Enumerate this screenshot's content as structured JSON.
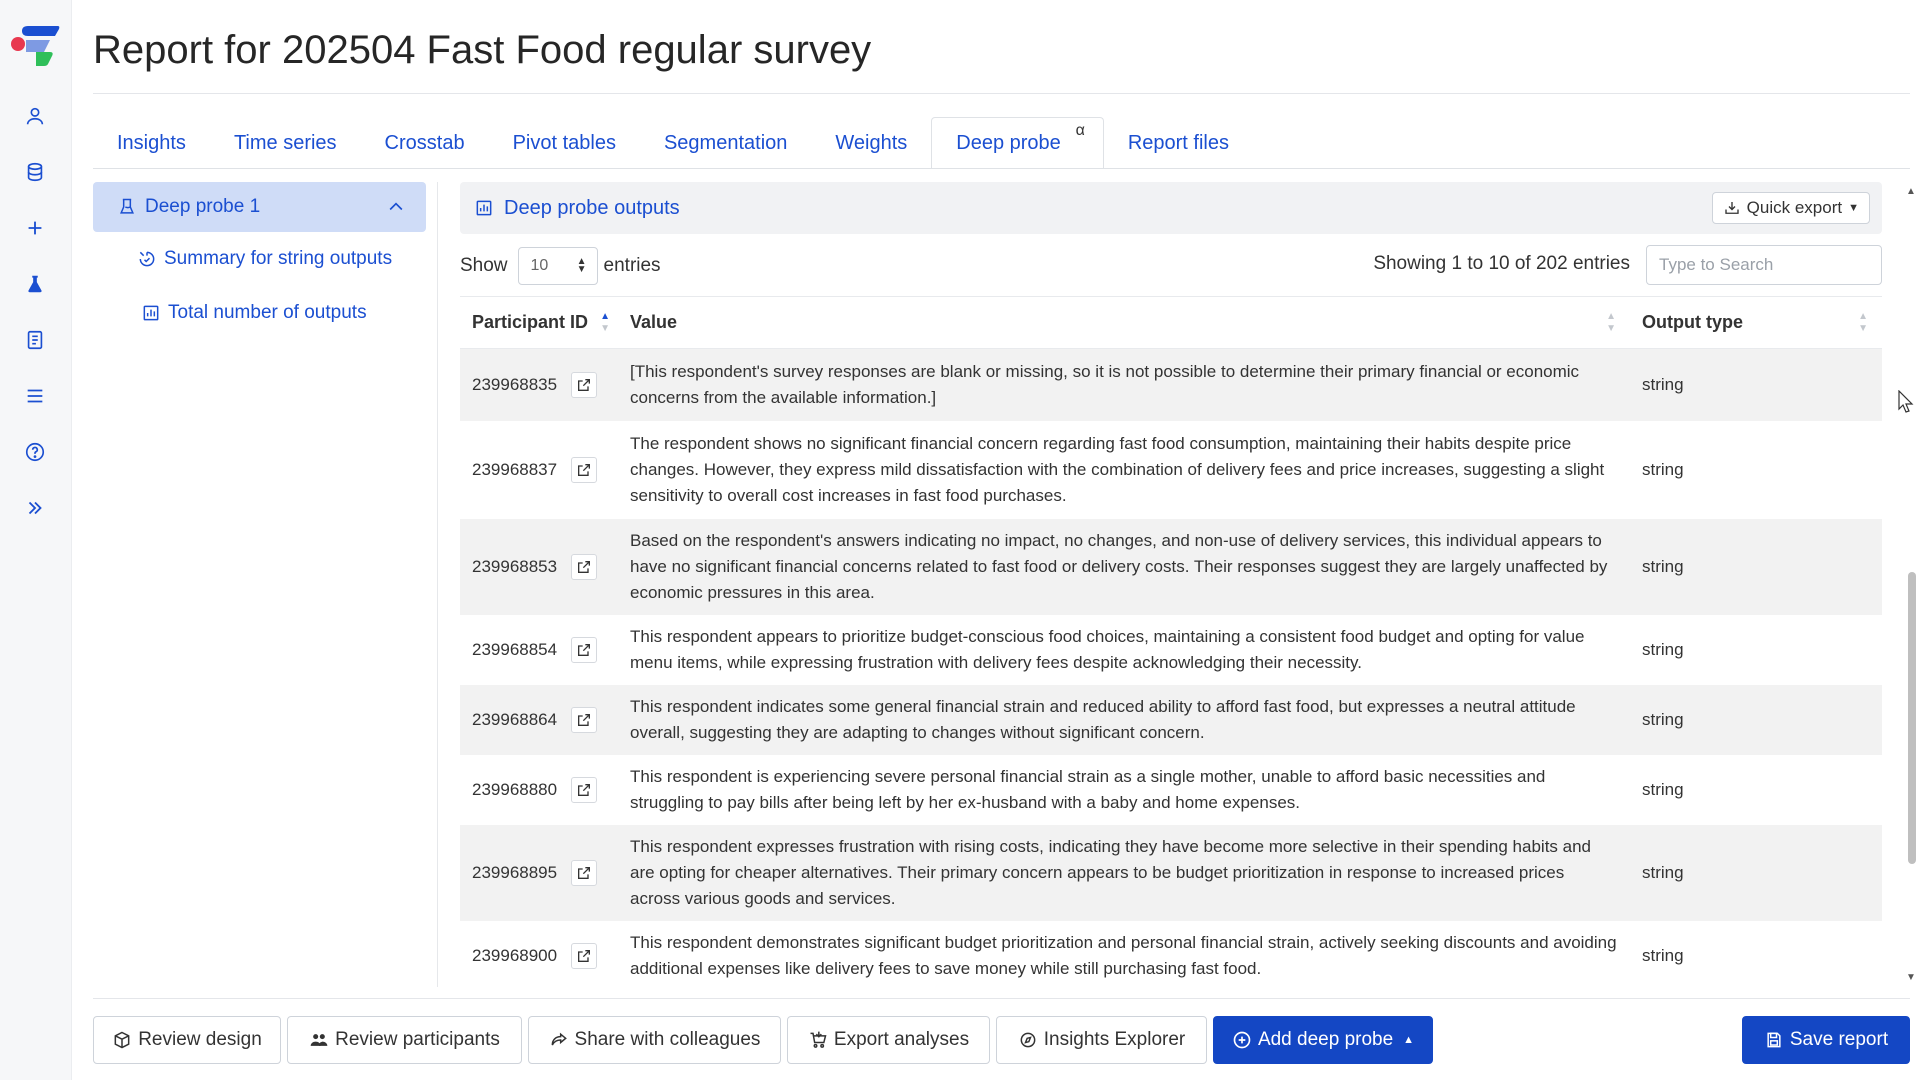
{
  "colors": {
    "accent": "#1b4fd1",
    "primary_button": "#1447c4",
    "selected_tree_bg": "#cfdcf7",
    "stripe": "#f2f2f2"
  },
  "rail": {
    "icons": [
      "user-icon",
      "database-icon",
      "plus-icon",
      "flask-icon",
      "book-icon",
      "menu-icon",
      "help-icon",
      "expand-icon"
    ]
  },
  "page": {
    "title": "Report for 202504 Fast Food regular survey"
  },
  "tabs": [
    {
      "label": "Insights"
    },
    {
      "label": "Time series"
    },
    {
      "label": "Crosstab"
    },
    {
      "label": "Pivot tables"
    },
    {
      "label": "Segmentation"
    },
    {
      "label": "Weights"
    },
    {
      "label": "Deep probe",
      "sup": "α",
      "active": true
    },
    {
      "label": "Report files"
    }
  ],
  "tree": {
    "head": "Deep probe 1",
    "items": [
      {
        "label": "Summary for string outputs"
      },
      {
        "label": "Total number of outputs"
      }
    ]
  },
  "panel": {
    "title": "Deep probe outputs",
    "quick_export": "Quick export",
    "show_label": "Show",
    "page_length": "10",
    "entries_label": "entries",
    "showing": "Showing 1 to 10 of 202 entries",
    "search_placeholder": "Type to Search"
  },
  "table": {
    "headers": [
      "Participant ID",
      "Value",
      "Output type"
    ],
    "rows": [
      {
        "id": "239968835",
        "value": "[This respondent's survey responses are blank or missing, so it is not possible to determine their primary financial or economic concerns from the available information.]",
        "type": "string"
      },
      {
        "id": "239968837",
        "value": "The respondent shows no significant financial concern regarding fast food consumption, maintaining their habits despite price changes. However, they express mild dissatisfaction with the combination of delivery fees and price increases, suggesting a slight sensitivity to overall cost increases in fast food purchases.",
        "type": "string"
      },
      {
        "id": "239968853",
        "value": "Based on the respondent's answers indicating no impact, no changes, and non-use of delivery services, this individual appears to have no significant financial concerns related to fast food or delivery costs. Their responses suggest they are largely unaffected by economic pressures in this area.",
        "type": "string"
      },
      {
        "id": "239968854",
        "value": "This respondent appears to prioritize budget-conscious food choices, maintaining a consistent food budget and opting for value menu items, while expressing frustration with delivery fees despite acknowledging their necessity.",
        "type": "string"
      },
      {
        "id": "239968864",
        "value": "This respondent indicates some general financial strain and reduced ability to afford fast food, but expresses a neutral attitude overall, suggesting they are adapting to changes without significant concern.",
        "type": "string"
      },
      {
        "id": "239968880",
        "value": "This respondent is experiencing severe personal financial strain as a single mother, unable to afford basic necessities and struggling to pay bills after being left by her ex-husband with a baby and home expenses.",
        "type": "string"
      },
      {
        "id": "239968895",
        "value": "This respondent expresses frustration with rising costs, indicating they have become more selective in their spending habits and are opting for cheaper alternatives. Their primary concern appears to be budget prioritization in response to increased prices across various goods and services.",
        "type": "string"
      },
      {
        "id": "239968900",
        "value": "This respondent demonstrates significant budget prioritization and personal financial strain, actively seeking discounts and avoiding additional expenses like delivery fees to save money while still purchasing fast food.",
        "type": "string"
      }
    ]
  },
  "footer": {
    "review_design": "Review design",
    "review_participants": "Review participants",
    "share": "Share with colleagues",
    "export": "Export analyses",
    "explorer": "Insights Explorer",
    "add_probe": "Add deep probe",
    "save": "Save report"
  }
}
